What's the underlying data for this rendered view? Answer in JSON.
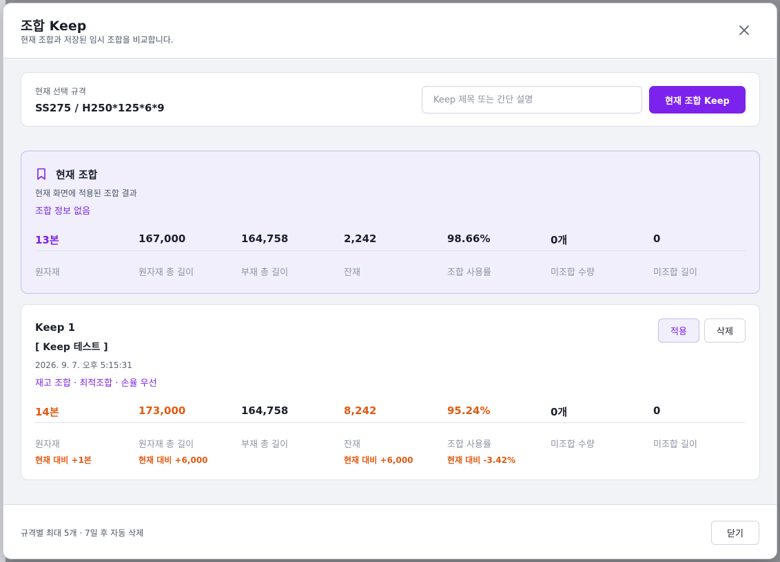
{
  "modal": {
    "title": "조합 Keep",
    "subtitle": "현재 조합과 저장된 임시 조합을 비교합니다.",
    "close_icon": "close-icon"
  },
  "spec": {
    "label": "현재 선택 규격",
    "value": "SS275 / H250*125*6*9",
    "input_placeholder": "Keep 제목 또는 간단 설명",
    "input_value": "",
    "keep_button": "현재 조합 Keep"
  },
  "current": {
    "icon": "bookmark-icon",
    "title": "현재 조합",
    "description": "현재 화면에 적용된 조합 결과",
    "info": "조합 정보 없음",
    "stats": [
      {
        "value": "13본",
        "label": "원자재"
      },
      {
        "value": "167,000",
        "label": "원자재 총 길이"
      },
      {
        "value": "164,758",
        "label": "부재 총 길이"
      },
      {
        "value": "2,242",
        "label": "잔재"
      },
      {
        "value": "98.66%",
        "label": "조합 사용률"
      },
      {
        "value": "0개",
        "label": "미조합 수량"
      },
      {
        "value": "0",
        "label": "미조합 길이"
      }
    ]
  },
  "keeps": [
    {
      "name": "Keep 1",
      "memo": "[ Keep 테스트 ]",
      "date": "2026. 9. 7. 오후 5:15:31",
      "tags": "재고 조합 · 최적조합 · 손율 우선",
      "apply_label": "적용",
      "delete_label": "삭제",
      "stats": [
        {
          "value": "14본",
          "label": "원자재",
          "diff": "현재 대비 +1본"
        },
        {
          "value": "173,000",
          "label": "원자재 총 길이",
          "diff": "현재 대비 +6,000"
        },
        {
          "value": "164,758",
          "label": "부재 총 길이",
          "diff": ""
        },
        {
          "value": "8,242",
          "label": "잔재",
          "diff": "현재 대비 +6,000"
        },
        {
          "value": "95.24%",
          "label": "조합 사용률",
          "diff": "현재 대비 -3.42%"
        },
        {
          "value": "0개",
          "label": "미조합 수량",
          "diff": ""
        },
        {
          "value": "0",
          "label": "미조합 길이",
          "diff": ""
        }
      ]
    }
  ],
  "footer": {
    "note": "규격별 최대 5개 · 7일 후 자동 삭제",
    "close_label": "닫기"
  },
  "colors": {
    "accent": "#7b22ec",
    "diff": "#e25a12",
    "current_bg": "#f0effb"
  }
}
